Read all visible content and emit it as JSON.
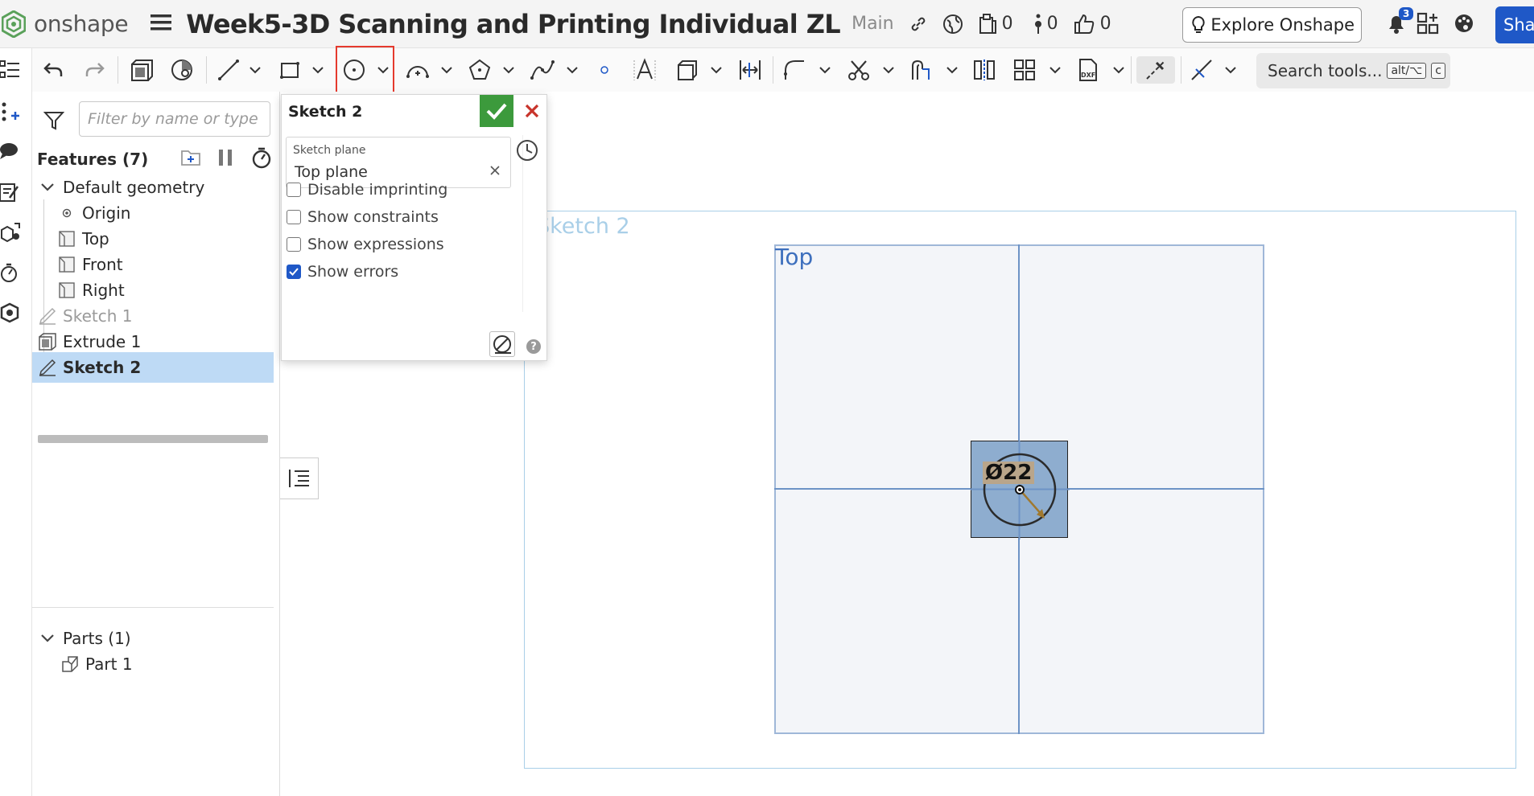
{
  "header": {
    "logo_text": "onshape",
    "doc_title": "Week5-3D Scanning and Printing Individual ZL",
    "branch": "Main",
    "versions_count": "0",
    "tasks_count": "0",
    "likes_count": "0",
    "explore_label": "Explore Onshape",
    "notifications_count": "3",
    "share_label": "Share"
  },
  "toolbar": {
    "search_label": "Search tools...",
    "shortcut_1": "alt/⌥",
    "shortcut_2": "c"
  },
  "feature_panel": {
    "filter_placeholder": "Filter by name or type",
    "features_label": "Features (7)",
    "items": [
      {
        "label": "Default geometry"
      },
      {
        "label": "Origin"
      },
      {
        "label": "Top"
      },
      {
        "label": "Front"
      },
      {
        "label": "Right"
      },
      {
        "label": "Sketch 1"
      },
      {
        "label": "Extrude 1"
      },
      {
        "label": "Sketch 2"
      }
    ],
    "parts_label": "Parts (1)",
    "parts": [
      {
        "label": "Part 1"
      }
    ]
  },
  "sketch_dialog": {
    "title": "Sketch 2",
    "plane_label": "Sketch plane",
    "plane_value": "Top plane",
    "options": [
      {
        "label": "Disable imprinting",
        "checked": false
      },
      {
        "label": "Show constraints",
        "checked": false
      },
      {
        "label": "Show expressions",
        "checked": false
      },
      {
        "label": "Show errors",
        "checked": true
      }
    ]
  },
  "viewport": {
    "sketch_label": "Sketch 2",
    "plane_label": "Top",
    "dimension_label": "Ø22"
  },
  "colors": {
    "accent": "#1f58c7",
    "ok_green": "#3c9a3c",
    "cancel_red": "#c8342b",
    "highlight_red": "#e53a2e",
    "plane_blue": "#3d6fbd",
    "selected_row": "#bedaf5"
  }
}
